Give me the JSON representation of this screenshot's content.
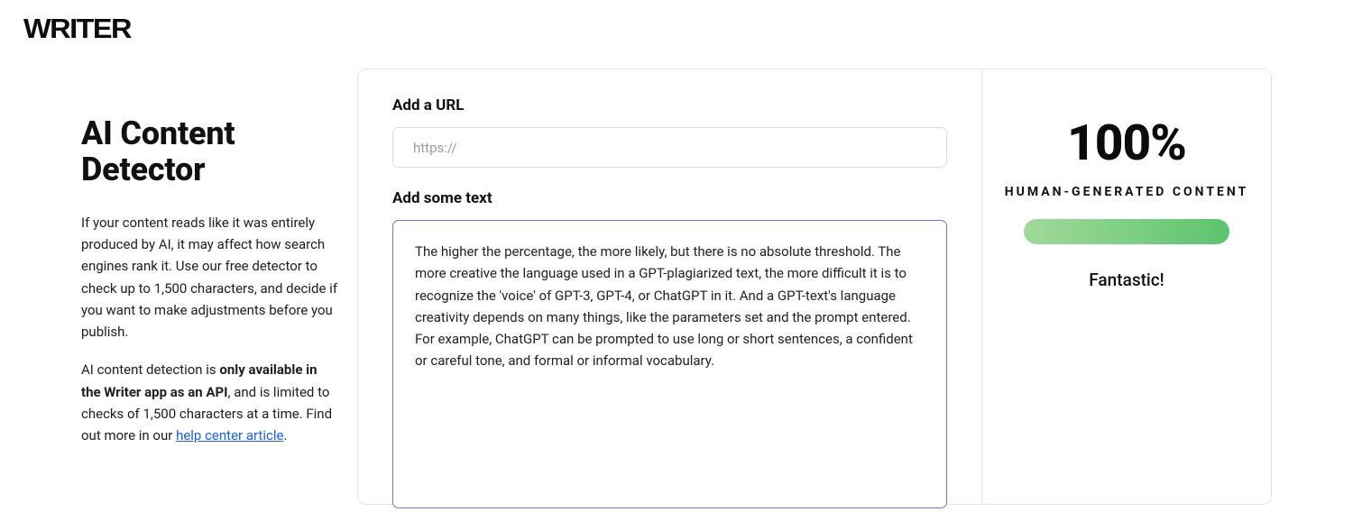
{
  "brand": {
    "logo": "WRITER"
  },
  "left": {
    "title": "AI Content Detector",
    "para1": "If your content reads like it was entirely produced by AI, it may affect how search engines rank it. Use our free detector to check up to 1,500 characters, and decide if you want to make adjustments before you publish.",
    "para2_pre": "AI content detection is ",
    "para2_bold": "only available in the Writer app as an API",
    "para2_mid": ", and is limited to checks of 1,500 characters at a time. Find out more in our ",
    "para2_link": "help center article",
    "para2_post": "."
  },
  "form": {
    "url_label": "Add a URL",
    "url_placeholder": "https://",
    "url_value": "",
    "text_label": "Add some text",
    "text_value": "The higher the percentage, the more likely, but there is no absolute threshold. The more creative the language used in a GPT-plagiarized text, the more difficult it is to recognize the 'voice' of GPT-3, GPT-4, or ChatGPT in it. And a GPT-text's language creativity depends on many things, like the parameters set and the prompt entered. For example, ChatGPT can be prompted to use long or short sentences, a confident or careful tone, and formal or informal vocabulary."
  },
  "result": {
    "percent": "100%",
    "label": "HUMAN-GENERATED CONTENT",
    "comment": "Fantastic!"
  }
}
